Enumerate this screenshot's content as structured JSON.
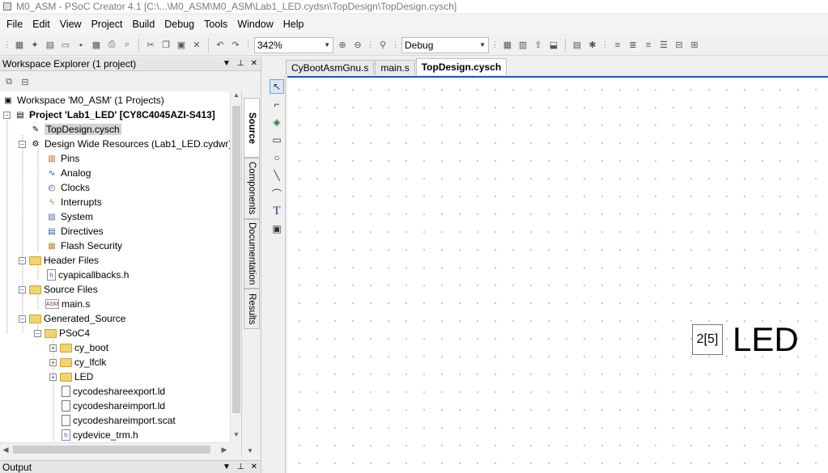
{
  "window": {
    "title": "M0_ASM - PSoC Creator 4.1  [C:\\...\\M0_ASM\\M0_ASM\\Lab1_LED.cydsn\\TopDesign\\TopDesign.cysch]"
  },
  "menu": [
    {
      "label": "File",
      "key": "F"
    },
    {
      "label": "Edit",
      "key": "E"
    },
    {
      "label": "View",
      "key": "V"
    },
    {
      "label": "Project",
      "key": "P"
    },
    {
      "label": "Build",
      "key": "B"
    },
    {
      "label": "Debug",
      "key": "D"
    },
    {
      "label": "Tools",
      "key": "T"
    },
    {
      "label": "Window",
      "key": "W"
    },
    {
      "label": "Help",
      "key": "H"
    }
  ],
  "toolbar": {
    "zoom_value": "342%",
    "config_value": "Debug"
  },
  "workspace": {
    "panel_title": "Workspace Explorer (1 project)",
    "pin_glyph": "↕",
    "close_glyph": "✖",
    "tree": [
      {
        "label": "Workspace 'M0_ASM' (1 Projects)",
        "icon": "workspace-icon"
      },
      {
        "label": "Project 'Lab1_LED' [CY8C4045AZI-S413]",
        "icon": "project-icon"
      },
      {
        "label": "TopDesign.cysch",
        "icon": "schematic-icon"
      },
      {
        "label": "Design Wide Resources (Lab1_LED.cydwr)",
        "icon": "resources-icon"
      },
      {
        "label": "Pins",
        "icon": "pins-icon"
      },
      {
        "label": "Analog",
        "icon": "analog-icon"
      },
      {
        "label": "Clocks",
        "icon": "clock-icon"
      },
      {
        "label": "Interrupts",
        "icon": "interrupt-icon"
      },
      {
        "label": "System",
        "icon": "system-icon"
      },
      {
        "label": "Directives",
        "icon": "directives-icon"
      },
      {
        "label": "Flash Security",
        "icon": "flash-security-icon"
      },
      {
        "label": "Header Files",
        "icon": "folder-icon"
      },
      {
        "label": "cyapicallbacks.h",
        "icon": "header-file-icon"
      },
      {
        "label": "Source Files",
        "icon": "folder-icon"
      },
      {
        "label": "main.s",
        "icon": "asm-file-icon"
      },
      {
        "label": "Generated_Source",
        "icon": "folder-icon"
      },
      {
        "label": "PSoC4",
        "icon": "folder-icon"
      },
      {
        "label": "cy_boot",
        "icon": "folder-icon"
      },
      {
        "label": "cy_lfclk",
        "icon": "folder-icon"
      },
      {
        "label": "LED",
        "icon": "folder-icon"
      },
      {
        "label": "cycodeshareexport.ld",
        "icon": "document-icon"
      },
      {
        "label": "cycodeshareimport.ld",
        "icon": "document-icon"
      },
      {
        "label": "cycodeshareimport.scat",
        "icon": "document-icon"
      },
      {
        "label": "cydevice_trm.h",
        "icon": "header-file-icon"
      }
    ],
    "side_tabs": [
      "Source",
      "Components",
      "Documentation",
      "Results"
    ]
  },
  "output": {
    "panel_title": "Output"
  },
  "editor": {
    "tabs": [
      {
        "label": "CyBootAsmGnu.s"
      },
      {
        "label": "main.s"
      },
      {
        "label": "TopDesign.cysch"
      }
    ],
    "component": {
      "pin_label": "2[5]",
      "name": "LED"
    }
  }
}
